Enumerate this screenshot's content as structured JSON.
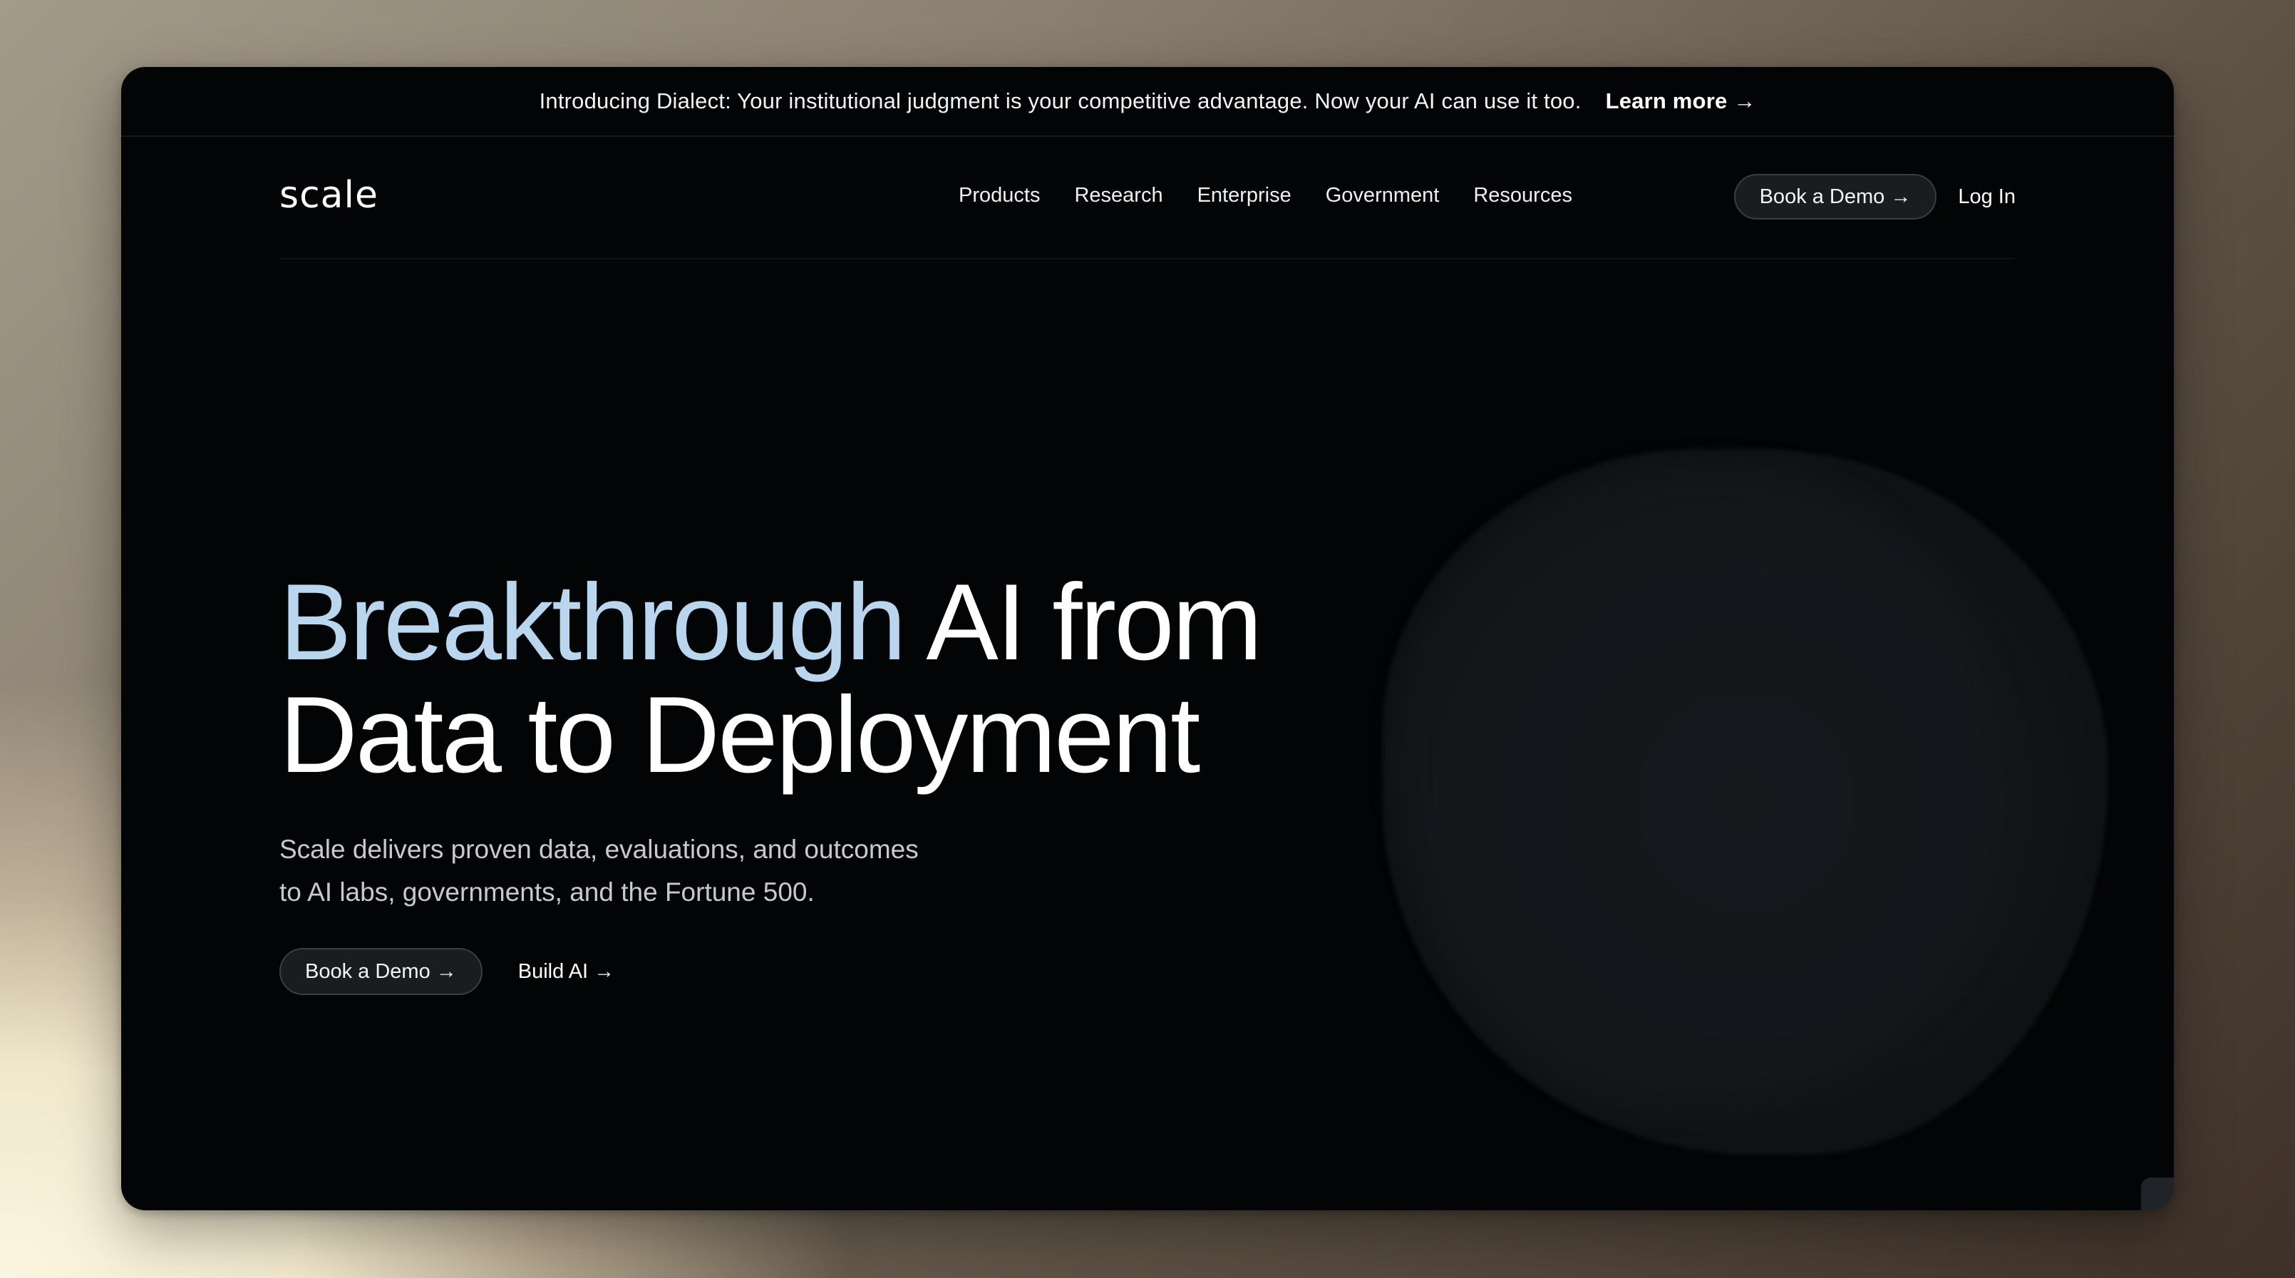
{
  "announcement": {
    "text": "Introducing Dialect: Your institutional judgment is your competitive advantage. Now your AI can use it too.",
    "link_label": "Learn more →"
  },
  "nav": {
    "logo": "scale",
    "links": [
      "Products",
      "Research",
      "Enterprise",
      "Government",
      "Resources"
    ],
    "book_demo_label": "Book a Demo →",
    "login_label": "Log In"
  },
  "hero": {
    "title_accent": "Breakthrough",
    "title_rest_line1": " AI from",
    "title_line2": "Data to Deployment",
    "subtitle_line1": "Scale delivers proven data, evaluations, and outcomes",
    "subtitle_line2": "to AI labs, governments, and the Fortune 500.",
    "book_demo_label": "Book a Demo →",
    "build_label": "Build AI →"
  },
  "colors": {
    "accent": "#b9d6ee",
    "background": "#030405"
  }
}
